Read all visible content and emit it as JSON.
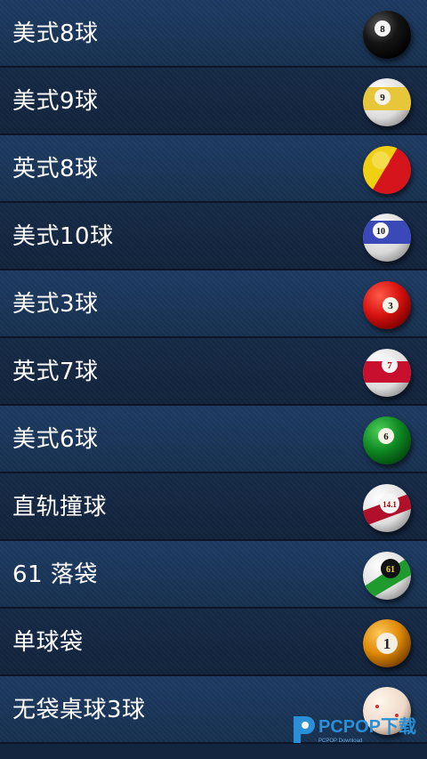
{
  "games": [
    {
      "label": "美式8球",
      "ball": {
        "icon": "eight-ball-icon",
        "number": "8"
      }
    },
    {
      "label": "美式9球",
      "ball": {
        "icon": "nine-ball-icon",
        "number": "9"
      }
    },
    {
      "label": "英式8球",
      "ball": {
        "icon": "english-eight-ball-icon",
        "number": ""
      }
    },
    {
      "label": "美式10球",
      "ball": {
        "icon": "ten-ball-icon",
        "number": "10"
      }
    },
    {
      "label": "美式3球",
      "ball": {
        "icon": "three-ball-icon",
        "number": "3"
      }
    },
    {
      "label": "英式7球",
      "ball": {
        "icon": "seven-ball-icon",
        "number": "7"
      }
    },
    {
      "label": "美式6球",
      "ball": {
        "icon": "six-ball-icon",
        "number": "6"
      }
    },
    {
      "label": "直轨撞球",
      "ball": {
        "icon": "straight-pool-ball-icon",
        "number": "14.1"
      }
    },
    {
      "label": "61 落袋",
      "ball": {
        "icon": "sixty-one-ball-icon",
        "number": "61"
      }
    },
    {
      "label": "单球袋",
      "ball": {
        "icon": "one-pocket-ball-icon",
        "number": "1"
      }
    },
    {
      "label": "无袋桌球3球",
      "ball": {
        "icon": "carom-ball-icon",
        "number": ""
      }
    }
  ],
  "watermark": {
    "text": "PCPOP下载",
    "subtext": "PCPOP Download"
  },
  "colors": {
    "row_light": "#1d3a63",
    "row_dark": "#12233c",
    "text": "#ffffff"
  }
}
